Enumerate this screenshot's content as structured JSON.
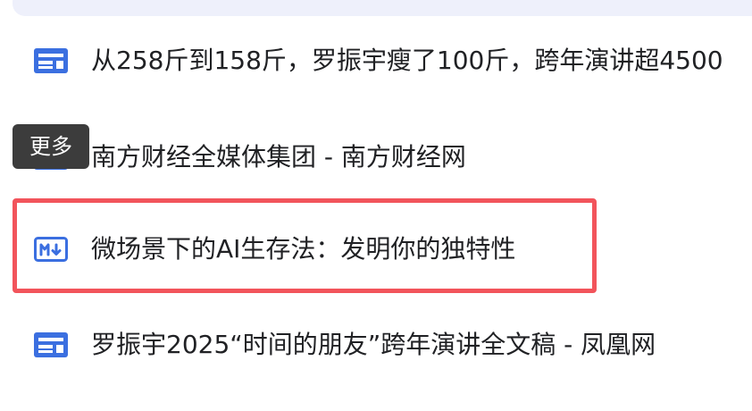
{
  "items": [
    {
      "icon": "article-icon",
      "label": "从258斤到158斤，罗振宇瘦了100斤，跨年演讲超4500"
    },
    {
      "icon": "article-icon",
      "label": "南方财经全媒体集团 - 南方财经网"
    },
    {
      "icon": "markdown-icon",
      "label": "微场景下的AI生存法：发明你的独特性"
    },
    {
      "icon": "article-icon",
      "label": "罗振宇2025“时间的朋友”跨年演讲全文稿 - 凤凰网"
    }
  ],
  "tooltip": {
    "text": "更多"
  },
  "colors": {
    "icon_blue": "#3b6fe0",
    "highlight_red": "#f2545b",
    "tooltip_bg": "#3c3c3c",
    "top_strip_bg": "#eef0fb"
  }
}
